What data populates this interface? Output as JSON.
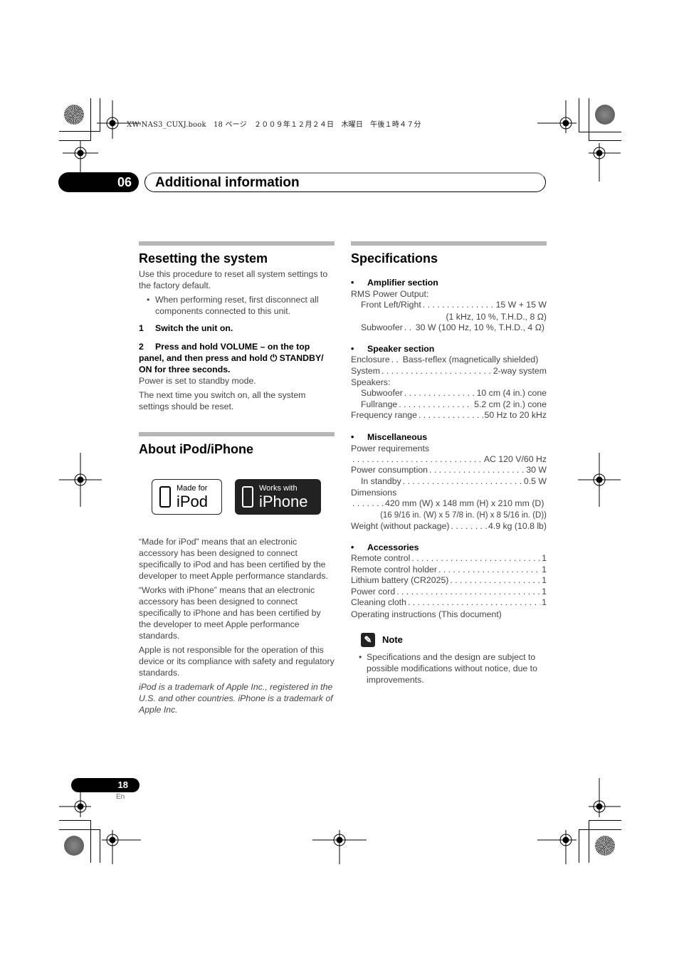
{
  "print_header": "XW-NAS3_CUXJ.book　18 ページ　２００９年１２月２４日　木曜日　午後１時４７分",
  "chapter": {
    "number": "06",
    "title": "Additional information"
  },
  "reset": {
    "title": "Resetting the system",
    "intro": "Use this procedure to reset all system settings to the factory default.",
    "bullet": "When performing reset, first disconnect all components connected to this unit.",
    "step1_num": "1",
    "step1": "Switch the unit on.",
    "step2_num": "2",
    "step2": "Press and hold VOLUME – on the top panel, and then press and hold ⏻ STANDBY/ ON for three seconds.",
    "result": "Power is set to standby mode.",
    "after": "The next time you switch on, all the system settings should be reset."
  },
  "ipod": {
    "title": "About iPod/iPhone",
    "logo_ipod_small": "Made for",
    "logo_ipod_big": "iPod",
    "logo_iphone_small": "Works with",
    "logo_iphone_big": "iPhone",
    "para1": "“Made for iPod” means that an electronic accessory has been designed to connect specifically to iPod and has been certified by the developer to meet Apple performance standards.",
    "para2": "“Works with iPhone” means that an electronic accessory has been designed to connect specifically to iPhone and has been certified by the developer to meet Apple performance standards.",
    "para3": "Apple is not responsible for the operation of this device or its compliance with safety and regulatory standards.",
    "trademark": "iPod is a trademark of Apple Inc., registered in the U.S. and other countries. iPhone is a trademark of Apple Inc."
  },
  "specs": {
    "title": "Specifications",
    "amp": {
      "head": "Amplifier section",
      "rms": "RMS Power Output:",
      "front_k": "Front Left/Right",
      "front_v": "15 W + 15 W",
      "front_cond": "(1 kHz, 10 %, T.H.D., 8 Ω)",
      "sub_k": "Subwoofer",
      "sub_v": "30 W  (100 Hz, 10 %, T.H.D., 4 Ω)"
    },
    "speaker": {
      "head": "Speaker section",
      "enclosure_k": "Enclosure",
      "enclosure_v": "Bass-reflex (magnetically shielded)",
      "system_k": "System",
      "system_v": "2-way system",
      "speakers": "Speakers:",
      "sub_k": "Subwoofer",
      "sub_v": "10 cm (4 in.) cone",
      "full_k": "Fullrange",
      "full_v": "5.2 cm (2 in.) cone",
      "freq_k": "Frequency range",
      "freq_v": "50 Hz to 20 kHz"
    },
    "misc": {
      "head": "Miscellaneous",
      "power_req": "Power requirements",
      "power_req_v": "AC 120 V/60 Hz",
      "consumption_k": "Power consumption",
      "consumption_v": "30 W",
      "standby_k": "In standby",
      "standby_v": "0.5 W",
      "dimensions": "Dimensions",
      "dim_mm": "420 mm (W) x 148 mm (H) x 210 mm (D)",
      "dim_in": "(16 9/16 in. (W) x 5 7/8 in. (H) x 8 5/16 in. (D))",
      "weight_k": "Weight (without package)",
      "weight_v": "4.9 kg (10.8 lb)"
    },
    "accessories": {
      "head": "Accessories",
      "items": [
        {
          "k": "Remote control",
          "v": "1"
        },
        {
          "k": "Remote control holder",
          "v": "1"
        },
        {
          "k": "Lithium battery (CR2025)",
          "v": "1"
        },
        {
          "k": "Power cord",
          "v": "1"
        },
        {
          "k": "Cleaning cloth",
          "v": "1"
        }
      ],
      "last": "Operating instructions (This document)"
    },
    "note": {
      "head": "Note",
      "bullet": "Specifications and the design are subject to possible modifications without notice, due to improvements."
    }
  },
  "footer": {
    "page": "18",
    "lang": "En"
  }
}
